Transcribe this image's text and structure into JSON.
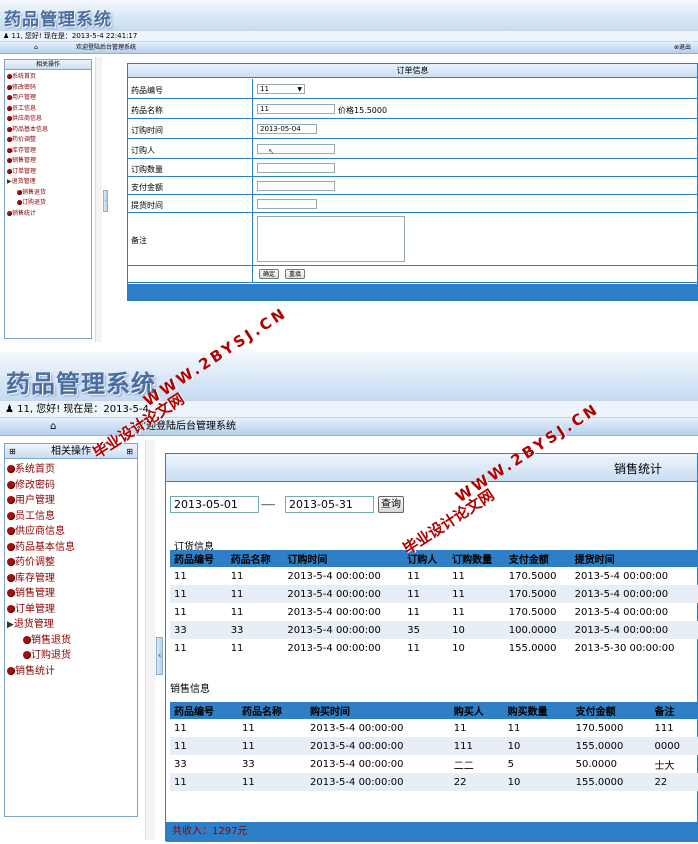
{
  "app": {
    "title": "药品管理系统"
  },
  "userbar": {
    "text": "11, 您好! 现在是：2013-5-4 22:41:17",
    "text_bottom": "11, 您好! 现在是：2013-5-4"
  },
  "nav": {
    "welcome": "欢迎登陆后台管理系统",
    "logout": "退出"
  },
  "sidebar": {
    "heading": "相关操作",
    "items": [
      "系统首页",
      "修改密码",
      "用户管理",
      "员工信息",
      "供应商信息",
      "药品基本信息",
      "药价调整",
      "库存管理",
      "销售管理",
      "订单管理",
      "退货管理"
    ],
    "sub_items": [
      "销售退货",
      "订购退货"
    ],
    "last_item": "销售统计"
  },
  "order_form": {
    "title": "订单信息",
    "fields": {
      "drug_id": {
        "label": "药品编号",
        "value": "11"
      },
      "drug_name": {
        "label": "药品名称",
        "value": "11",
        "price": "价格15.5000"
      },
      "order_time": {
        "label": "订购时间",
        "value": "2013-05-04"
      },
      "orderer": {
        "label": "订购人",
        "value": ""
      },
      "quantity": {
        "label": "订购数量",
        "value": ""
      },
      "amount": {
        "label": "支付金额",
        "value": ""
      },
      "pickup_time": {
        "label": "提货时间",
        "value": ""
      },
      "remark": {
        "label": "备注",
        "value": ""
      }
    },
    "confirm": "确定",
    "reset": "重填"
  },
  "stats": {
    "title": "销售统计",
    "date_from": "2013-05-01",
    "date_sep": "-------",
    "date_to": "2013-05-31",
    "query": "查询",
    "order_section": "订货信息",
    "order_headers": [
      "药品编号",
      "药品名称",
      "订购时间",
      "订购人",
      "订购数量",
      "支付金额",
      "提货时间"
    ],
    "order_rows": [
      [
        "11",
        "11",
        "2013-5-4 00:00:00",
        "11",
        "11",
        "170.5000",
        "2013-5-4 00:00:00"
      ],
      [
        "11",
        "11",
        "2013-5-4 00:00:00",
        "11",
        "11",
        "170.5000",
        "2013-5-4 00:00:00"
      ],
      [
        "11",
        "11",
        "2013-5-4 00:00:00",
        "11",
        "11",
        "170.5000",
        "2013-5-4 00:00:00"
      ],
      [
        "33",
        "33",
        "2013-5-4 00:00:00",
        "35",
        "10",
        "100.0000",
        "2013-5-4 00:00:00"
      ],
      [
        "11",
        "11",
        "2013-5-4 00:00:00",
        "11",
        "10",
        "155.0000",
        "2013-5-30 00:00:00"
      ]
    ],
    "sales_section": "销售信息",
    "sales_headers": [
      "药品编号",
      "药品名称",
      "购买时间",
      "购买人",
      "购买数量",
      "支付金额",
      "备注"
    ],
    "sales_rows": [
      [
        "11",
        "11",
        "2013-5-4 00:00:00",
        "11",
        "11",
        "170.5000",
        "111"
      ],
      [
        "11",
        "11",
        "2013-5-4 00:00:00",
        "111",
        "10",
        "155.0000",
        "0000"
      ],
      [
        "33",
        "33",
        "2013-5-4 00:00:00",
        "二二",
        "5",
        "50.0000",
        "士大"
      ],
      [
        "11",
        "11",
        "2013-5-4 00:00:00",
        "22",
        "10",
        "155.0000",
        "22"
      ]
    ],
    "income": "共收入：1297元"
  },
  "watermarks": {
    "url": "WWW.2BYSJ.CN",
    "cn": "毕业设计论文网"
  },
  "colors": {
    "accent": "#2f7fc6",
    "menu_text": "#8b0000",
    "title_blue": "#4a6ea0",
    "header_bg": "#d7e6f6"
  }
}
